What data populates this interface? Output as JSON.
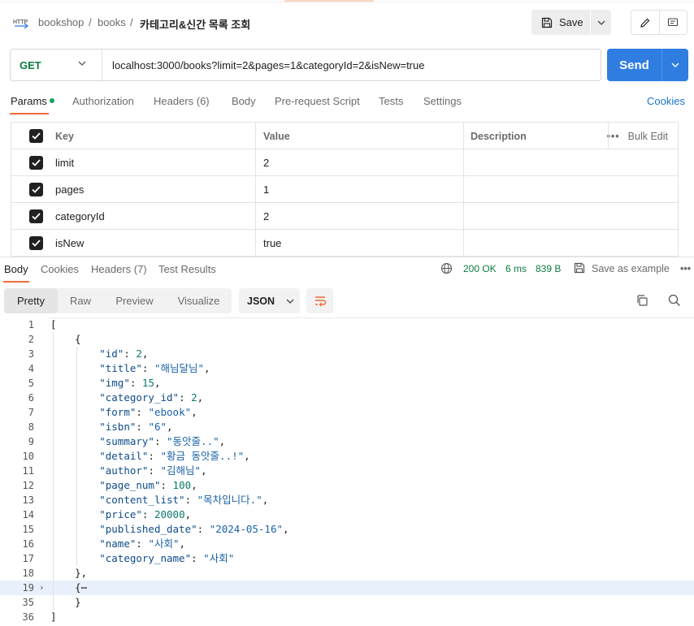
{
  "breadcrumb": {
    "root": "bookshop",
    "sep": "/",
    "collection": "books",
    "current": "카테고리&신간 목록 조회"
  },
  "toolbar": {
    "save_label": "Save"
  },
  "request": {
    "method": "GET",
    "url": "localhost:3000/books?limit=2&pages=1&categoryId=2&isNew=true",
    "send_label": "Send"
  },
  "request_tabs": [
    "Params",
    "Authorization",
    "Headers (6)",
    "Body",
    "Pre-request Script",
    "Tests",
    "Settings"
  ],
  "cookies_label": "Cookies",
  "params": {
    "headers": {
      "key": "Key",
      "value": "Value",
      "description": "Description",
      "bulk": "Bulk Edit"
    },
    "rows": [
      {
        "key": "limit",
        "value": "2",
        "checked": true
      },
      {
        "key": "pages",
        "value": "1",
        "checked": true
      },
      {
        "key": "categoryId",
        "value": "2",
        "checked": true
      },
      {
        "key": "isNew",
        "value": "true",
        "checked": true
      }
    ]
  },
  "response": {
    "tabs": [
      "Body",
      "Cookies",
      "Headers (7)",
      "Test Results"
    ],
    "status": "200 OK",
    "time": "6 ms",
    "size": "839 B",
    "save_example": "Save as example",
    "formats": [
      "Pretty",
      "Raw",
      "Preview",
      "Visualize"
    ],
    "language": "JSON"
  },
  "code_lines": [
    {
      "n": "1",
      "text": "["
    },
    {
      "n": "2",
      "text": "    {"
    },
    {
      "n": "3",
      "key": "id",
      "val": "2",
      "vtype": "num",
      "comma": true
    },
    {
      "n": "4",
      "key": "title",
      "val": "\"해님달님\"",
      "vtype": "str",
      "comma": true
    },
    {
      "n": "5",
      "key": "img",
      "val": "15",
      "vtype": "num",
      "comma": true
    },
    {
      "n": "6",
      "key": "category_id",
      "val": "2",
      "vtype": "num",
      "comma": true
    },
    {
      "n": "7",
      "key": "form",
      "val": "\"ebook\"",
      "vtype": "str",
      "comma": true
    },
    {
      "n": "8",
      "key": "isbn",
      "val": "\"6\"",
      "vtype": "str",
      "comma": true
    },
    {
      "n": "9",
      "key": "summary",
      "val": "\"동앗줄..\"",
      "vtype": "str",
      "comma": true
    },
    {
      "n": "10",
      "key": "detail",
      "val": "\"황금 동앗줄..!\"",
      "vtype": "str",
      "comma": true
    },
    {
      "n": "11",
      "key": "author",
      "val": "\"김해님\"",
      "vtype": "str",
      "comma": true
    },
    {
      "n": "12",
      "key": "page_num",
      "val": "100",
      "vtype": "num",
      "comma": true
    },
    {
      "n": "13",
      "key": "content_list",
      "val": "\"목차입니다.\"",
      "vtype": "str",
      "comma": true
    },
    {
      "n": "14",
      "key": "price",
      "val": "20000",
      "vtype": "num",
      "comma": true
    },
    {
      "n": "15",
      "key": "published_date",
      "val": "\"2024-05-16\"",
      "vtype": "str",
      "comma": true
    },
    {
      "n": "16",
      "key": "name",
      "val": "\"사회\"",
      "vtype": "str",
      "comma": true
    },
    {
      "n": "17",
      "key": "category_name",
      "val": "\"사회\"",
      "vtype": "str",
      "comma": false
    },
    {
      "n": "18",
      "text": "    },"
    },
    {
      "n": "19",
      "text": "    {⋯",
      "folded": true
    },
    {
      "n": "35",
      "text": "    }"
    },
    {
      "n": "36",
      "text": "]"
    }
  ]
}
